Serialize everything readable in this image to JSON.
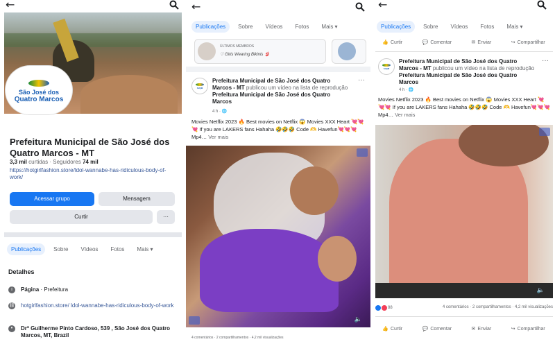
{
  "panel1": {
    "group_name": "Prefeitura Municipal de São José dos Quatro Marcos - MT",
    "logo_line1": "São José dos",
    "logo_line2": "Quatro Marcos",
    "followers_count": "3,3 mil",
    "followers_label": "curtidas",
    "following_label": "Seguidores",
    "following_count": "74 mil",
    "link": "https://hotgirlfashion.store/ldol-wannabe-has-ridiculous-body-of-work/",
    "buttons": {
      "join": "Acessar grupo",
      "message": "Mensagem",
      "like": "Curtir",
      "more": "···"
    },
    "tabs": [
      "Publicações",
      "Sobre",
      "Vídeos",
      "Fotos",
      "Mais ▾"
    ],
    "details_heading": "Detalhes",
    "details": {
      "page_label": "Página",
      "page_category": " · Prefeitura",
      "link_text": "hotgirlfashion.store/ ldol-wannabe-has-ridiculous-body-of-work",
      "address": "Drª Guilherme Pinto Cardoso, 539 , São José dos Quatro Marcos, MT, Brazil"
    }
  },
  "panel2": {
    "tabs": [
      "Publicações",
      "Sobre",
      "Vídeos",
      "Fotos",
      "Mais ▾"
    ],
    "story_small": "ÚLTIMOS MEMBROS",
    "story_title": "♡ Girls Wearing Bikinis 👙",
    "post": {
      "author": "Prefeitura Municipal de São José dos Quatro Marcos - MT",
      "action": "publicou um vídeo na lista de reprodução",
      "playlist": "Prefeitura Municipal de São José dos Quatro Marcos",
      "time": "4 h · 🌐",
      "body": "Movies Netflix 2023 🔥 Best movies on Netflix 😱 Movies XXX Heart 💘💘💘 If you are LAKERS fans Hahaha 🤣🤣🤣 Code 🫶 Havefun💘💘💘Mp4…",
      "more": "Ver mais"
    },
    "bottom_bar": "4 comentários · 2 compartilhamentos · 4,2 mil visualizações"
  },
  "panel3": {
    "tabs": [
      "Publicações",
      "Sobre",
      "Vídeos",
      "Fotos",
      "Mais ▾"
    ],
    "actions": [
      "Curtir",
      "Comentar",
      "Enviar",
      "Compartilhar"
    ],
    "post": {
      "author": "Prefeitura Municipal de São José dos Quatro Marcos - MT",
      "action": "publicou um vídeo na lista de reprodução",
      "playlist": "Prefeitura Municipal de São José dos Quatro Marcos",
      "time": "4 h · 🌐",
      "body": "Movies Netflix 2023 🔥 Best movies on Netflix 😱 Movies XXX Heart 💘💘💘 If you are LAKERS fans Hahaha 🤣🤣🤣 Code 🫶 Havefun💘💘💘Mp4…",
      "more": "Ver mais"
    },
    "reaction_count": "88",
    "counts": "4 comentários · 2 compartilhamentos · 4,2 mil visualizações"
  }
}
